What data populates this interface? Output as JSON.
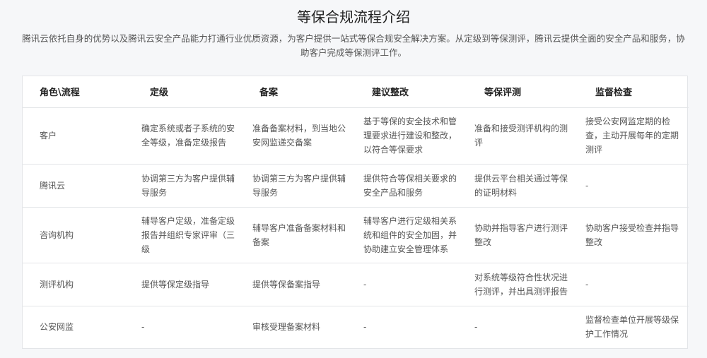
{
  "title": "等保合规流程介绍",
  "description": "腾讯云依托自身的优势以及腾讯云安全产品能力打通行业优质资源，为客户提供一站式等保合规安全解决方案。从定级到等保测评，腾讯云提供全面的安全产品和服务，协助客户完成等保测评工作。",
  "table": {
    "headers": [
      "角色\\流程",
      "定级",
      "备案",
      "建议整改",
      "等保评测",
      "监督检查"
    ],
    "rows": [
      [
        "客户",
        "确定系统或者子系统的安全等级，准备定级报告",
        "准备备案材料，到当地公安网监递交备案",
        "基于等保的安全技术和管理要求进行建设和整改，以符合等保要求",
        "准备和接受测评机构的测评",
        "接受公安网监定期的检查，主动开展每年的定期测评"
      ],
      [
        "腾讯云",
        "协调第三方为客户提供辅导服务",
        "协调第三方为客户提供辅导服务",
        "提供符合等保相关要求的安全产品和服务",
        "提供云平台相关通过等保的证明材料",
        "-"
      ],
      [
        "咨询机构",
        "辅导客户定级，准备定级报告并组织专家评审（三级",
        "辅导客户准备备案材料和备案",
        "辅导客户进行定级相关系统和组件的安全加固，并协助建立安全管理体系",
        "协助并指导客户进行测评整改",
        "协助客户接受检查并指导整改"
      ],
      [
        "测评机构",
        "提供等保定级指导",
        "提供等保备案指导",
        "-",
        "对系统等级符合性状况进行测评，并出具测评报告",
        "-"
      ],
      [
        "公安网监",
        "-",
        "审核受理备案材料",
        "-",
        "-",
        "监督检查单位开展等级保护工作情况"
      ]
    ]
  }
}
